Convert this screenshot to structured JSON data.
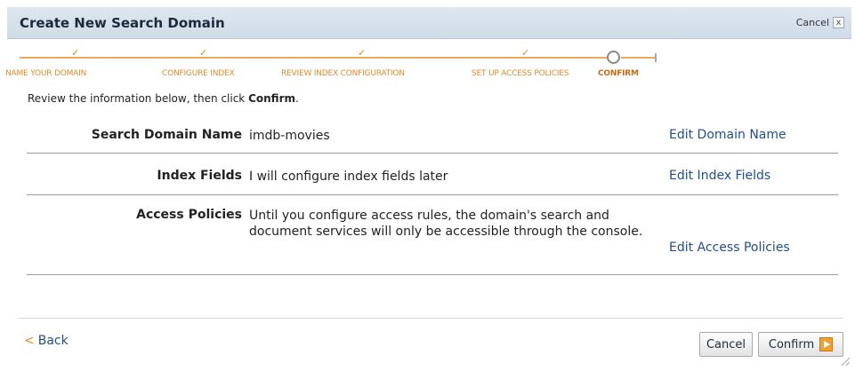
{
  "dialog": {
    "title": "Create New Search Domain",
    "cancel_top_label": "Cancel",
    "close_symbol": "x"
  },
  "steps": [
    {
      "label": "NAME YOUR DOMAIN",
      "status": "complete"
    },
    {
      "label": "CONFIGURE INDEX",
      "status": "complete"
    },
    {
      "label": "REVIEW INDEX CONFIGURATION",
      "status": "complete"
    },
    {
      "label": "SET UP ACCESS POLICIES",
      "status": "complete"
    },
    {
      "label": "CONFIRM",
      "status": "current"
    }
  ],
  "check_symbol": "✓",
  "instructions": {
    "prefix": "Review the information below, then click ",
    "emphasis": "Confirm",
    "suffix": "."
  },
  "review": [
    {
      "label": "Search Domain Name",
      "value": "imdb-movies",
      "edit": "Edit Domain Name"
    },
    {
      "label": "Index Fields",
      "value": "I will configure index fields later",
      "edit": "Edit Index Fields"
    },
    {
      "label": "Access Policies",
      "value": "Until you configure access rules, the domain's search and document services will only be accessible through the console.",
      "edit": "Edit Access Policies"
    }
  ],
  "footer": {
    "back_arrow": "<",
    "back_label": "Back",
    "cancel_label": "Cancel",
    "confirm_label": "Confirm"
  },
  "colors": {
    "accent_orange": "#e08a26",
    "link_blue": "#1f4e8c",
    "titlebar": "#cfdbe7"
  }
}
